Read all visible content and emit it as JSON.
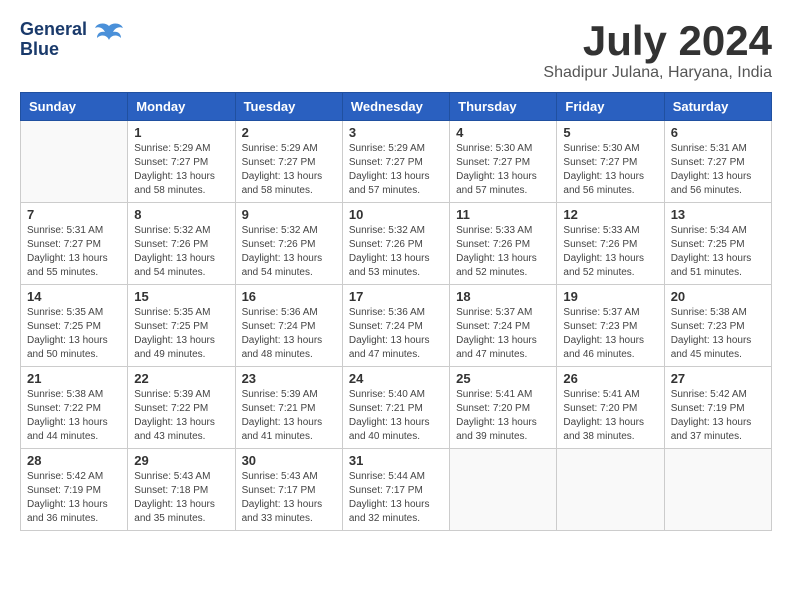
{
  "logo": {
    "line1": "General",
    "line2": "Blue"
  },
  "title": "July 2024",
  "location": "Shadipur Julana, Haryana, India",
  "weekdays": [
    "Sunday",
    "Monday",
    "Tuesday",
    "Wednesday",
    "Thursday",
    "Friday",
    "Saturday"
  ],
  "weeks": [
    [
      {
        "day": "",
        "info": ""
      },
      {
        "day": "1",
        "info": "Sunrise: 5:29 AM\nSunset: 7:27 PM\nDaylight: 13 hours\nand 58 minutes."
      },
      {
        "day": "2",
        "info": "Sunrise: 5:29 AM\nSunset: 7:27 PM\nDaylight: 13 hours\nand 58 minutes."
      },
      {
        "day": "3",
        "info": "Sunrise: 5:29 AM\nSunset: 7:27 PM\nDaylight: 13 hours\nand 57 minutes."
      },
      {
        "day": "4",
        "info": "Sunrise: 5:30 AM\nSunset: 7:27 PM\nDaylight: 13 hours\nand 57 minutes."
      },
      {
        "day": "5",
        "info": "Sunrise: 5:30 AM\nSunset: 7:27 PM\nDaylight: 13 hours\nand 56 minutes."
      },
      {
        "day": "6",
        "info": "Sunrise: 5:31 AM\nSunset: 7:27 PM\nDaylight: 13 hours\nand 56 minutes."
      }
    ],
    [
      {
        "day": "7",
        "info": "Sunrise: 5:31 AM\nSunset: 7:27 PM\nDaylight: 13 hours\nand 55 minutes."
      },
      {
        "day": "8",
        "info": "Sunrise: 5:32 AM\nSunset: 7:26 PM\nDaylight: 13 hours\nand 54 minutes."
      },
      {
        "day": "9",
        "info": "Sunrise: 5:32 AM\nSunset: 7:26 PM\nDaylight: 13 hours\nand 54 minutes."
      },
      {
        "day": "10",
        "info": "Sunrise: 5:32 AM\nSunset: 7:26 PM\nDaylight: 13 hours\nand 53 minutes."
      },
      {
        "day": "11",
        "info": "Sunrise: 5:33 AM\nSunset: 7:26 PM\nDaylight: 13 hours\nand 52 minutes."
      },
      {
        "day": "12",
        "info": "Sunrise: 5:33 AM\nSunset: 7:26 PM\nDaylight: 13 hours\nand 52 minutes."
      },
      {
        "day": "13",
        "info": "Sunrise: 5:34 AM\nSunset: 7:25 PM\nDaylight: 13 hours\nand 51 minutes."
      }
    ],
    [
      {
        "day": "14",
        "info": "Sunrise: 5:35 AM\nSunset: 7:25 PM\nDaylight: 13 hours\nand 50 minutes."
      },
      {
        "day": "15",
        "info": "Sunrise: 5:35 AM\nSunset: 7:25 PM\nDaylight: 13 hours\nand 49 minutes."
      },
      {
        "day": "16",
        "info": "Sunrise: 5:36 AM\nSunset: 7:24 PM\nDaylight: 13 hours\nand 48 minutes."
      },
      {
        "day": "17",
        "info": "Sunrise: 5:36 AM\nSunset: 7:24 PM\nDaylight: 13 hours\nand 47 minutes."
      },
      {
        "day": "18",
        "info": "Sunrise: 5:37 AM\nSunset: 7:24 PM\nDaylight: 13 hours\nand 47 minutes."
      },
      {
        "day": "19",
        "info": "Sunrise: 5:37 AM\nSunset: 7:23 PM\nDaylight: 13 hours\nand 46 minutes."
      },
      {
        "day": "20",
        "info": "Sunrise: 5:38 AM\nSunset: 7:23 PM\nDaylight: 13 hours\nand 45 minutes."
      }
    ],
    [
      {
        "day": "21",
        "info": "Sunrise: 5:38 AM\nSunset: 7:22 PM\nDaylight: 13 hours\nand 44 minutes."
      },
      {
        "day": "22",
        "info": "Sunrise: 5:39 AM\nSunset: 7:22 PM\nDaylight: 13 hours\nand 43 minutes."
      },
      {
        "day": "23",
        "info": "Sunrise: 5:39 AM\nSunset: 7:21 PM\nDaylight: 13 hours\nand 41 minutes."
      },
      {
        "day": "24",
        "info": "Sunrise: 5:40 AM\nSunset: 7:21 PM\nDaylight: 13 hours\nand 40 minutes."
      },
      {
        "day": "25",
        "info": "Sunrise: 5:41 AM\nSunset: 7:20 PM\nDaylight: 13 hours\nand 39 minutes."
      },
      {
        "day": "26",
        "info": "Sunrise: 5:41 AM\nSunset: 7:20 PM\nDaylight: 13 hours\nand 38 minutes."
      },
      {
        "day": "27",
        "info": "Sunrise: 5:42 AM\nSunset: 7:19 PM\nDaylight: 13 hours\nand 37 minutes."
      }
    ],
    [
      {
        "day": "28",
        "info": "Sunrise: 5:42 AM\nSunset: 7:19 PM\nDaylight: 13 hours\nand 36 minutes."
      },
      {
        "day": "29",
        "info": "Sunrise: 5:43 AM\nSunset: 7:18 PM\nDaylight: 13 hours\nand 35 minutes."
      },
      {
        "day": "30",
        "info": "Sunrise: 5:43 AM\nSunset: 7:17 PM\nDaylight: 13 hours\nand 33 minutes."
      },
      {
        "day": "31",
        "info": "Sunrise: 5:44 AM\nSunset: 7:17 PM\nDaylight: 13 hours\nand 32 minutes."
      },
      {
        "day": "",
        "info": ""
      },
      {
        "day": "",
        "info": ""
      },
      {
        "day": "",
        "info": ""
      }
    ]
  ]
}
